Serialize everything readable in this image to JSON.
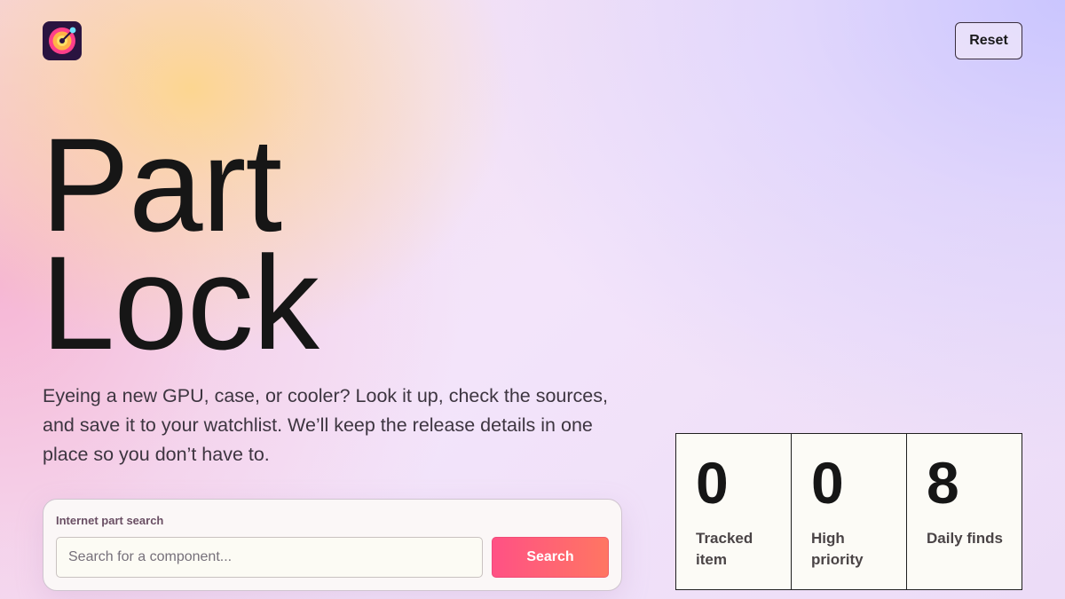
{
  "header": {
    "logo_icon": "target-logo-icon",
    "reset_label": "Reset"
  },
  "hero": {
    "title_line1": "Part",
    "title_line2": "Lock",
    "lead": "Eyeing a new GPU, case, or cooler? Look it up, check the sources, and save it to your watchlist. We’ll keep the release details in one place so you don’t have to."
  },
  "search": {
    "label": "Internet part search",
    "placeholder": "Search for a component...",
    "value": "",
    "button_label": "Search"
  },
  "stats": [
    {
      "value": "0",
      "label": "Tracked item"
    },
    {
      "value": "0",
      "label": "High priority"
    },
    {
      "value": "8",
      "label": "Daily finds"
    }
  ],
  "colors": {
    "accent_start": "#ff5185",
    "accent_end": "#ff7662",
    "logo_bg": "#2a1440"
  }
}
